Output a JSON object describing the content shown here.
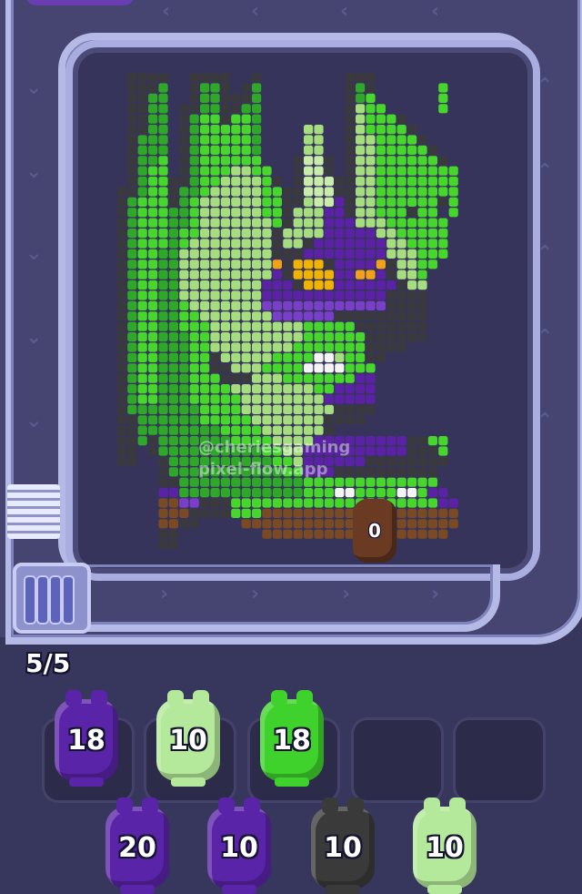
{
  "game": {
    "progress_text": "5/5",
    "watermark_lines": [
      "@cheriesgaming",
      "pixel-flow.app"
    ],
    "runner": {
      "count": "0",
      "color": "#6a3a23"
    },
    "slots": [
      {
        "count": "18",
        "color": "#5a24a8"
      },
      {
        "count": "10",
        "color": "#b4e89a"
      },
      {
        "count": "18",
        "color": "#3fd12c"
      },
      {
        "count": null
      },
      {
        "count": null
      }
    ],
    "queue": [
      {
        "count": "20",
        "color": "#5a24a8"
      },
      {
        "count": "10",
        "color": "#5a24a8"
      },
      {
        "count": "10",
        "color": "#3a3a3a"
      },
      {
        "count": "10",
        "color": "#b4e89a"
      }
    ]
  },
  "palette": {
    "k": "#3a3a3e",
    "g": "#2fa82a",
    "G": "#46d62c",
    "l": "#a6dd7e",
    "L": "#c9ecaa",
    "p": "#5b22a6",
    "P": "#7a3fc8",
    "y": "#f0b400",
    "o": "#f2a21a",
    "b": "#7a4a24",
    "w": "#f4f4f4"
  },
  "pixel_art": [
    "...kkkk..kkkk..k........kkk.........",
    "...kkkg..kggk.kg........kgk......G..",
    "...kkgg..kggkkkg........kgG......G..",
    "...kkgg.kkggkkgg........klGG.....G..",
    "...kkgg.kgGGkGGg........klGGGk......",
    "...kkgg.kgGGGGGg....ll..klGGGGk.....",
    "...kggg.kgGGGGGg....ll..kllGGGGk....",
    "...kggg.kgGGGGGg....ll..kllGGGGGk...",
    "...kggG.kgGGGGGG...kLLk.kllGGGGGGk..",
    "...kgGG.kgGGGllGG..kLLk.kllGGGGGGGG.",
    "...kgGGkkgGGllllGk.kLLLkkllGGGGGGGG.",
    "..kkgGGkggGlllllGGkkLLLkkllGGGGGGGG.",
    "..kgGGGkgGllllllGGkklLLpkllGGGGGGkG.",
    "..kgGGGggGllllllGGklllppkllGGGkGG.G.",
    "..kgGGGggGlllllllGklllppplllGGGGGG..",
    "..kgGGGgGGlllllllkllllpppppllGGGGG..",
    "..kgGGGgGllllllllkllkpppppppllGGGG..",
    "..kgGGgglllllllllkkkpppppppplllGGG..",
    "..kgGGgglllllllllokyyykppppokllGG...",
    "..kgGGgglllllllllpkyyyyppoopkllG....",
    "..kgGGggllllllllpppkyyyppppppkll....",
    "..kgGGggllllllllppppppppppppkkkk....",
    "..kgGGggGlllllllPPPPPPPPPPPPkkkk....",
    "..kgGGggGGlllllllPPPPPPkkkkkkkkk....",
    "..kgGGggGGGlllllllllGGGGGkkkkkkk....",
    "..kgGGgggGGlllllllllGGGGGGkkkkkk....",
    "..kgGGgggGGllllllllGGGGGGGkkkk......",
    "..kgGGgggGGklllllGGGGwwlGGkk........",
    "..kgGGgggGGkklllGGGGwwwwGGG.........",
    "..kgGGgggGGGkkklllGGGGGGGpp.........",
    "..kgGGgggGGGGllllllllGGpppp.........",
    "..kgGGgggGGGGGllllllllppppp.........",
    "..kgggggggGGGGlllllllllkkkk.........",
    "..kkggggggGGGGGlllllllkkkk..........",
    "..kkggggggggGGGGllllllk.............",
    "..kkgkgggggggGGGGllllpppppppppkkGG..",
    "..kk.kggggggggggGGllppppppppppkkkG..",
    "..kk..kggggggggggGGlppppppkkkkkkkk..",
    "......kgggggggggggGGpppkkkkkkkkkk...",
    "......kkggggggggggggGGGGGGGGGGGGG...",
    "......ppggggggggggggGGGwwGGGGwwGpp..",
    "......bbPPkkkGGGGGGGGGGGGGGGGGGGGpp.",
    "......bbbkkkkGGGbbbbbbbbbbbbbbbbbbb.",
    "......bbkk....bbbbbbbbbbbbbbbbbbbbb.",
    "......kk........bbbbbbbbbbbbbbbbbb..",
    "......kk............................"
  ]
}
